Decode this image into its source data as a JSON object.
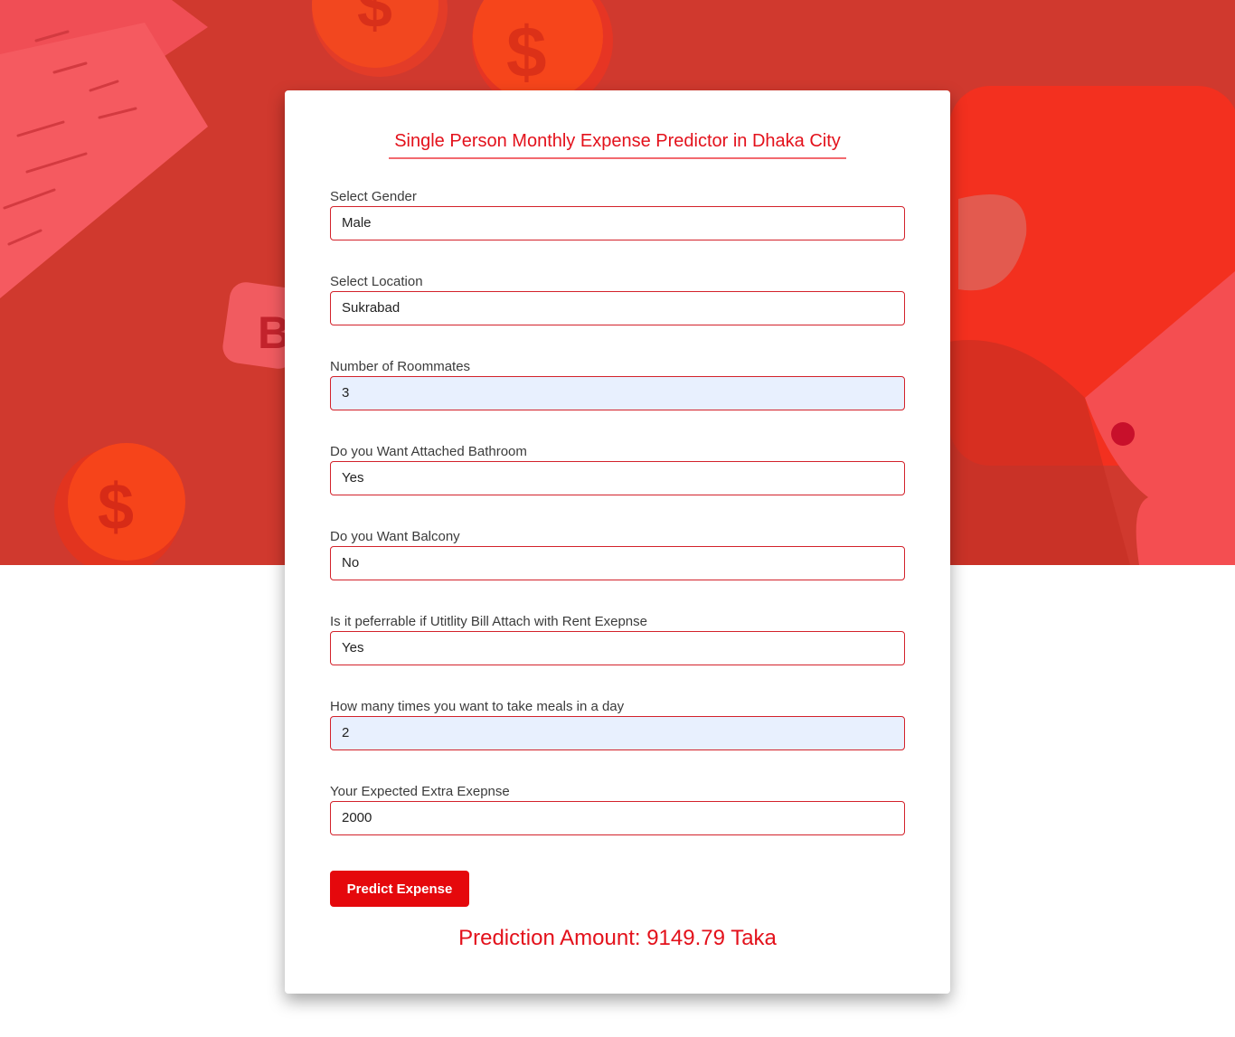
{
  "title": "Single Person Monthly Expense Predictor in Dhaka City",
  "fields": [
    {
      "label": "Select Gender",
      "value": "Male"
    },
    {
      "label": "Select Location",
      "value": "Sukrabad"
    },
    {
      "label": "Number of Roommates",
      "value": "3"
    },
    {
      "label": "Do you Want Attached Bathroom",
      "value": "Yes"
    },
    {
      "label": "Do you Want Balcony",
      "value": "No"
    },
    {
      "label": "Is it peferrable if Utitlity Bill Attach with Rent Exepnse",
      "value": "Yes"
    },
    {
      "label": "How many times you want to take meals in a day",
      "value": "2"
    },
    {
      "label": "Your Expected Extra Exepnse",
      "value": "2000"
    }
  ],
  "button_label": "Predict Expense",
  "result": "Prediction Amount: 9149.79 Taka",
  "colors": {
    "accent": "#e3111b",
    "hero_background": "#d0392e",
    "autofill_background": "#e8f0fe"
  },
  "hero_icons": [
    "receipt-icon",
    "dollar-coin-icon",
    "dollar-coin-icon",
    "dollar-coin-icon",
    "hand-icon"
  ]
}
